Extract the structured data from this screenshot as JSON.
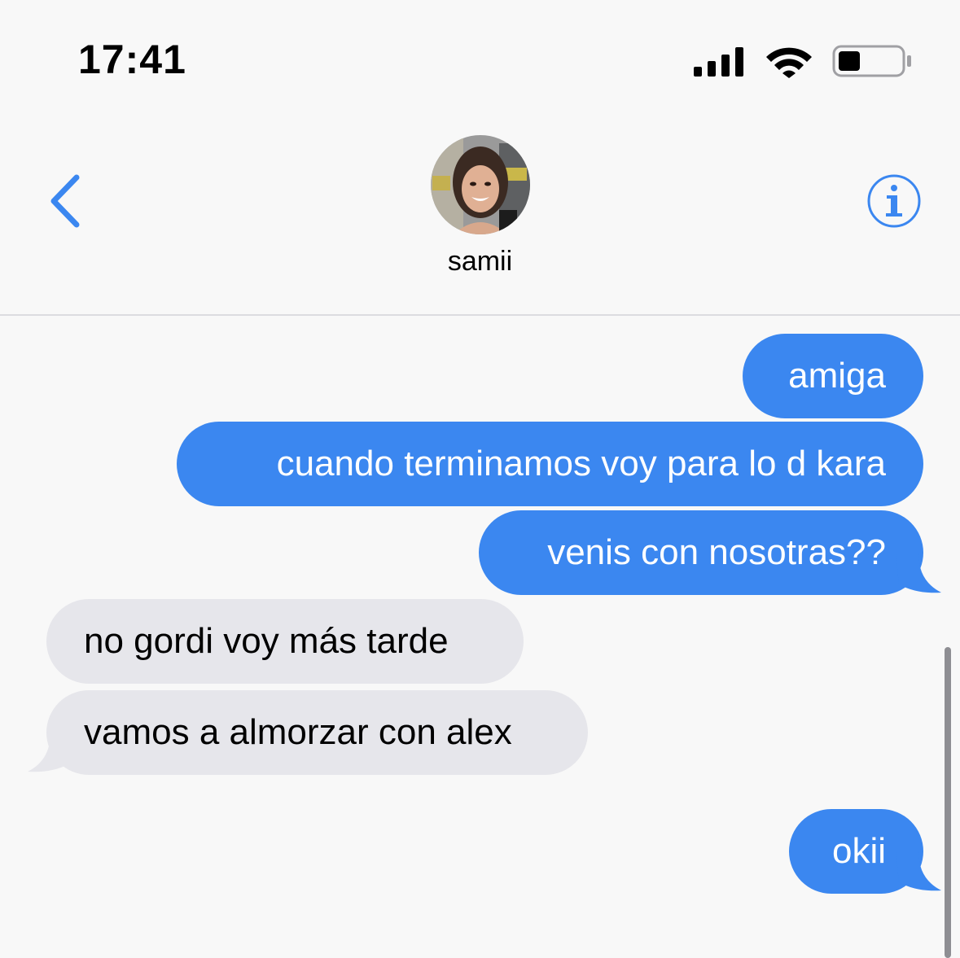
{
  "status_bar": {
    "time": "17:41",
    "signal_icon": "cellular-signal-icon",
    "wifi_icon": "wifi-icon",
    "battery_icon": "battery-icon",
    "battery_level": 0.35
  },
  "header": {
    "back_icon": "chevron-left-icon",
    "info_icon": "info-icon",
    "contact_name": "samii"
  },
  "messages": [
    {
      "direction": "sent",
      "text": "amiga"
    },
    {
      "direction": "sent",
      "text": "cuando terminamos voy para lo d kara"
    },
    {
      "direction": "sent",
      "text": "venis con nosotras??"
    },
    {
      "direction": "received",
      "text": "no gordi voy más tarde"
    },
    {
      "direction": "received",
      "text": "vamos a almorzar con alex"
    },
    {
      "direction": "sent",
      "text": "okii"
    }
  ],
  "colors": {
    "accent": "#3b87f0",
    "sent_bubble": "#3b87f0",
    "received_bubble": "#e6e6eb",
    "background": "#f8f8f8"
  }
}
